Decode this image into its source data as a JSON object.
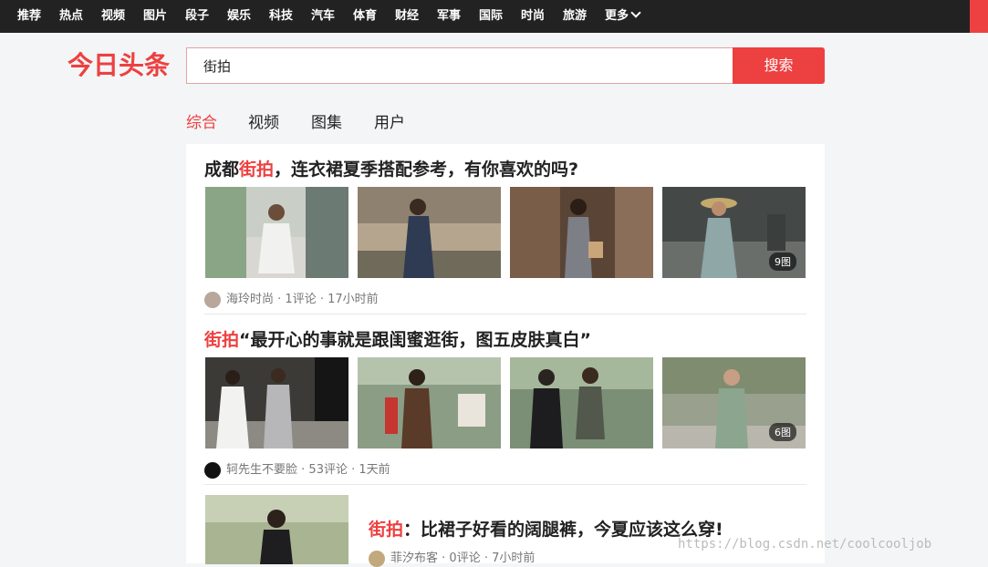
{
  "nav": {
    "items": [
      "推荐",
      "热点",
      "视频",
      "图片",
      "段子",
      "娱乐",
      "科技",
      "汽车",
      "体育",
      "财经",
      "军事",
      "国际",
      "时尚",
      "旅游",
      "更多"
    ]
  },
  "logo": {
    "text": "今日头条"
  },
  "search": {
    "value": "街拍",
    "button_label": "搜索"
  },
  "tabs": [
    "综合",
    "视频",
    "图集",
    "用户"
  ],
  "active_tab": "综合",
  "results": [
    {
      "title_prefix": "成都",
      "keyword": "街拍",
      "title_suffix": "，连衣裙夏季搭配参考，有你喜欢的吗?",
      "image_badge": "9图",
      "author": "海玲时尚",
      "comments": "1评论",
      "time": "17小时前"
    },
    {
      "title_prefix": "",
      "keyword": "街拍",
      "title_suffix": "“最开心的事就是跟闺蜜逛街，图五皮肤真白”",
      "image_badge": "6图",
      "author": "轲先生不要脸",
      "comments": "53评论",
      "time": "1天前"
    },
    {
      "title_prefix": "",
      "keyword": "街拍",
      "title_suffix": "：比裙子好看的阔腿裤，今夏应该这么穿!",
      "author": "菲汐布客",
      "comments": "0评论",
      "time": "7小时前"
    }
  ],
  "meta_separator": " · ",
  "watermark": "https://blog.csdn.net/coolcooljob",
  "colors": {
    "accent": "#ed4040",
    "nav_bg": "#222222",
    "page_bg": "#f4f5f6"
  }
}
